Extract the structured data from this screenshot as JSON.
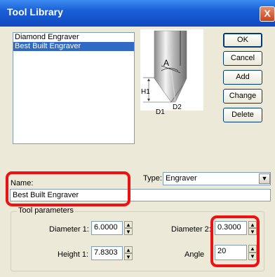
{
  "window": {
    "title": "Tool Library",
    "close_glyph": "X"
  },
  "tool_list": [
    {
      "label": "Diamond Engraver"
    },
    {
      "label": "Best Built Engraver"
    }
  ],
  "diagram_labels": {
    "angle": "A",
    "h1": "H1",
    "d2": "D2",
    "d1": "D1"
  },
  "buttons": {
    "ok": "OK",
    "cancel": "Cancel",
    "add": "Add",
    "change": "Change",
    "delete": "Delete"
  },
  "name_label": "Name:",
  "name_value": "Best Built Engraver",
  "type_label": "Type:",
  "type_value": "Engraver",
  "params": {
    "title": "Tool parameters",
    "diameter1_label": "Diameter 1:",
    "diameter1_value": "6.0000",
    "height1_label": "Height 1:",
    "height1_value": "7.8303",
    "diameter2_label": "Diameter 2:",
    "diameter2_value": "0.3000",
    "angle_label": "Angle",
    "angle_value": "20"
  },
  "icons": {
    "close": "close-icon",
    "dropdown": "chevron-down-icon",
    "spin_up": "triangle-up-icon",
    "spin_down": "triangle-down-icon",
    "diagram": "engraver-bit-diagram"
  },
  "colors": {
    "highlight": "#ee1111",
    "selection": "#316ac5",
    "titlebar": "#1a5fd6"
  }
}
